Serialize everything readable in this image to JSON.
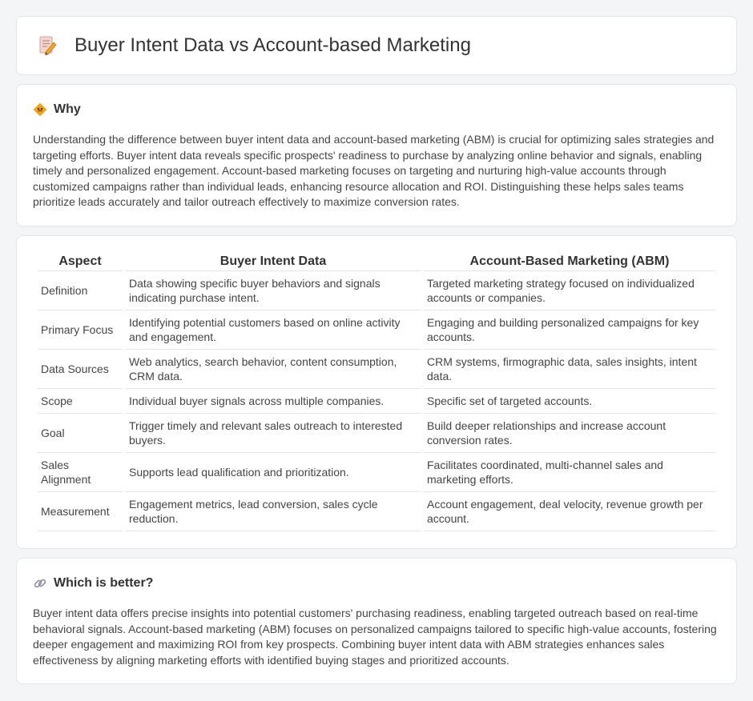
{
  "header": {
    "title": "Buyer Intent Data vs Account-based Marketing",
    "icon": "document-pencil-icon"
  },
  "why": {
    "heading": "Why",
    "icon": "diamond-sign-icon",
    "text": "Understanding the difference between buyer intent data and account-based marketing (ABM) is crucial for optimizing sales strategies and targeting efforts. Buyer intent data reveals specific prospects' readiness to purchase by analyzing online behavior and signals, enabling timely and personalized engagement. Account-based marketing focuses on targeting and nurturing high-value accounts through customized campaigns rather than individual leads, enhancing resource allocation and ROI. Distinguishing these helps sales teams prioritize leads accurately and tailor outreach effectively to maximize conversion rates."
  },
  "table": {
    "headers": [
      "Aspect",
      "Buyer Intent Data",
      "Account-Based Marketing (ABM)"
    ],
    "rows": [
      [
        "Definition",
        "Data showing specific buyer behaviors and signals indicating purchase intent.",
        "Targeted marketing strategy focused on individualized accounts or companies."
      ],
      [
        "Primary Focus",
        "Identifying potential customers based on online activity and engagement.",
        "Engaging and building personalized campaigns for key accounts."
      ],
      [
        "Data Sources",
        "Web analytics, search behavior, content consumption, CRM data.",
        "CRM systems, firmographic data, sales insights, intent data."
      ],
      [
        "Scope",
        "Individual buyer signals across multiple companies.",
        "Specific set of targeted accounts."
      ],
      [
        "Goal",
        "Trigger timely and relevant sales outreach to interested buyers.",
        "Build deeper relationships and increase account conversion rates."
      ],
      [
        "Sales Alignment",
        "Supports lead qualification and prioritization.",
        "Facilitates coordinated, multi-channel sales and marketing efforts."
      ],
      [
        "Measurement",
        "Engagement metrics, lead conversion, sales cycle reduction.",
        "Account engagement, deal velocity, revenue growth per account."
      ]
    ]
  },
  "better": {
    "heading": "Which is better?",
    "icon": "link-icon",
    "text": "Buyer intent data offers precise insights into potential customers' purchasing readiness, enabling targeted outreach based on real-time behavioral signals. Account-based marketing (ABM) focuses on personalized campaigns tailored to specific high-value accounts, fostering deeper engagement and maximizing ROI from key prospects. Combining buyer intent data with ABM strategies enhances sales effectiveness by aligning marketing efforts with identified buying stages and prioritized accounts."
  },
  "colors": {
    "background": "#f4f5f7",
    "card": "#ffffff",
    "border": "#e3e5e8",
    "accent_orange": "#f0a030"
  }
}
